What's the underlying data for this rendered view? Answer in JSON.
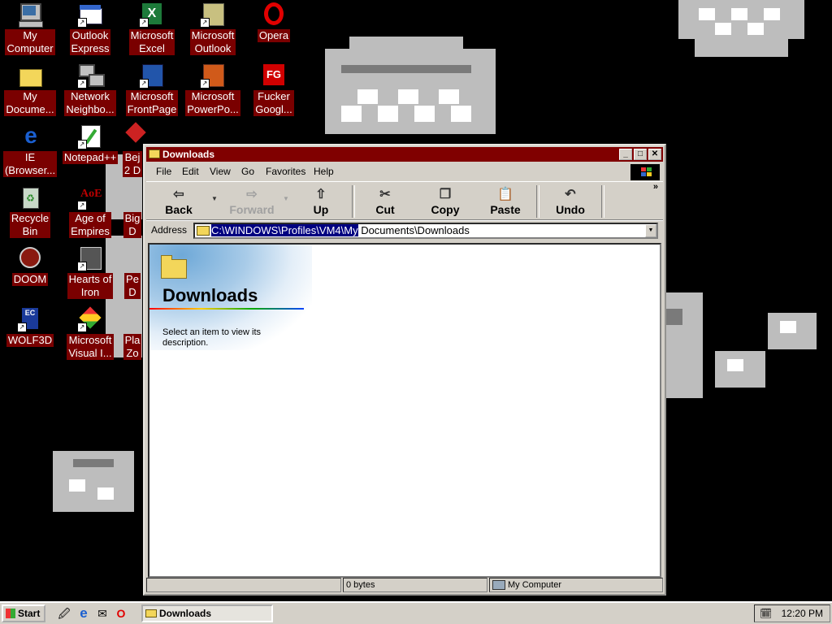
{
  "desktop": {
    "icons": [
      {
        "label": "My\nComputer"
      },
      {
        "label": "Outlook\nExpress"
      },
      {
        "label": "Microsoft\nExcel"
      },
      {
        "label": "Microsoft\nOutlook"
      },
      {
        "label": "Opera"
      },
      {
        "label": "My\nDocume..."
      },
      {
        "label": "Network\nNeighbo..."
      },
      {
        "label": "Microsoft\nFrontPage"
      },
      {
        "label": "Microsoft\nPowerPo..."
      },
      {
        "label": "Fucker\nGoogl..."
      },
      {
        "label": "IE\n(Browser..."
      },
      {
        "label": "Notepad++"
      },
      {
        "label": "Bej\n2 D"
      },
      {
        "label": "Recycle\nBin"
      },
      {
        "label": "Age of\nEmpires"
      },
      {
        "label": "Big\nD"
      },
      {
        "label": "DOOM"
      },
      {
        "label": "Hearts of\nIron"
      },
      {
        "label": "Pe\nD"
      },
      {
        "label": "WOLF3D"
      },
      {
        "label": "Microsoft\nVisual I..."
      },
      {
        "label": "Pla\nZo"
      }
    ]
  },
  "window": {
    "title": "Downloads",
    "menu": {
      "file": "File",
      "edit": "Edit",
      "view": "View",
      "go": "Go",
      "favorites": "Favorites",
      "help": "Help"
    },
    "toolbar": {
      "back": "Back",
      "forward": "Forward",
      "up": "Up",
      "cut": "Cut",
      "copy": "Copy",
      "paste": "Paste",
      "undo": "Undo"
    },
    "address": {
      "label": "Address",
      "selected_part": "C:\\WINDOWS\\Profiles\\VM4\\My",
      "rest": " Documents\\Downloads"
    },
    "content": {
      "title": "Downloads",
      "description": "Select an item to view its description."
    },
    "status": {
      "size": "0 bytes",
      "location": "My Computer"
    }
  },
  "taskbar": {
    "start_label": "Start",
    "task_label": "Downloads",
    "clock": "12:20 PM"
  }
}
